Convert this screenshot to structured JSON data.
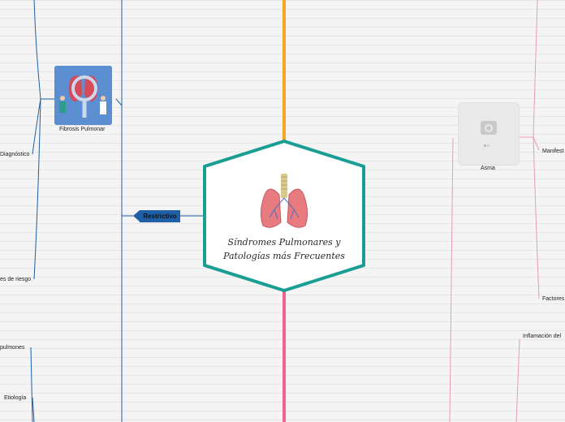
{
  "central_topic": {
    "title_line1": "Síndromes Pulmonares y",
    "title_line2": "Patologías más Frecuentes",
    "image": "lungs-icon"
  },
  "left_branch": {
    "label": "Restrictivo",
    "color": "#1f5fa6",
    "fibrosis": {
      "label": "Fibrosis Pulmonar",
      "image": "fibrosis-illustration"
    },
    "subtopics": [
      "Diagnóstico",
      "es de riesgo",
      "pulmones",
      "Etiología"
    ]
  },
  "right_branch": {
    "asma": {
      "label": "Asma",
      "image": "camera-placeholder-icon"
    },
    "subtopics": [
      "Manifest",
      "Factores",
      "Inflamación del"
    ],
    "color": "#e89bb0"
  },
  "connector_colors": {
    "top": "#f5a623",
    "bottom": "#f06292",
    "hexagon": "#1a9e94"
  }
}
